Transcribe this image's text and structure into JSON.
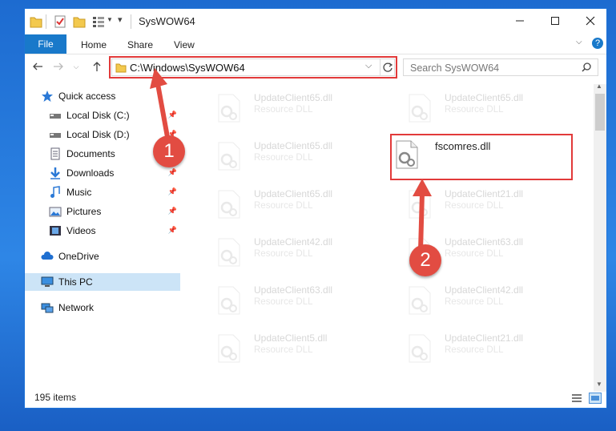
{
  "window": {
    "title": "SysWOW64"
  },
  "ribbon": {
    "file": "File",
    "home": "Home",
    "share": "Share",
    "view": "View",
    "help": "?"
  },
  "address": {
    "path": "C:\\Windows\\SysWOW64"
  },
  "search": {
    "placeholder": "Search SysWOW64"
  },
  "sidebar": {
    "items": [
      {
        "label": "Quick access"
      },
      {
        "label": "Local Disk (C:)"
      },
      {
        "label": "Local Disk (D:)"
      },
      {
        "label": "Documents"
      },
      {
        "label": "Downloads"
      },
      {
        "label": "Music"
      },
      {
        "label": "Pictures"
      },
      {
        "label": "Videos"
      },
      {
        "label": "OneDrive"
      },
      {
        "label": "This PC"
      },
      {
        "label": "Network"
      }
    ]
  },
  "files": [
    {
      "name": "UpdateClient65.dll",
      "type": "Resource DLL"
    },
    {
      "name": "UpdateClient65.dll",
      "type": "Resource DLL"
    },
    {
      "name": "UpdateClient65.dll",
      "type": "Resource DLL"
    },
    {
      "name": "fscomres.dll",
      "type": ""
    },
    {
      "name": "UpdateClient65.dll",
      "type": "Resource DLL"
    },
    {
      "name": "UpdateClient21.dll",
      "type": "Resource DLL"
    },
    {
      "name": "UpdateClient42.dll",
      "type": "Resource DLL"
    },
    {
      "name": "UpdateClient63.dll",
      "type": "Resource DLL"
    },
    {
      "name": "UpdateClient63.dll",
      "type": "Resource DLL"
    },
    {
      "name": "UpdateClient42.dll",
      "type": "Resource DLL"
    },
    {
      "name": "UpdateClient5.dll",
      "type": "Resource DLL"
    },
    {
      "name": "UpdateClient21.dll",
      "type": "Resource DLL"
    }
  ],
  "status": {
    "count": "195 items"
  },
  "annotations": {
    "step1": "1",
    "step2": "2"
  },
  "colors": {
    "accent": "#1979ca",
    "highlight": "#e23a3a",
    "badge": "#e24c42"
  }
}
